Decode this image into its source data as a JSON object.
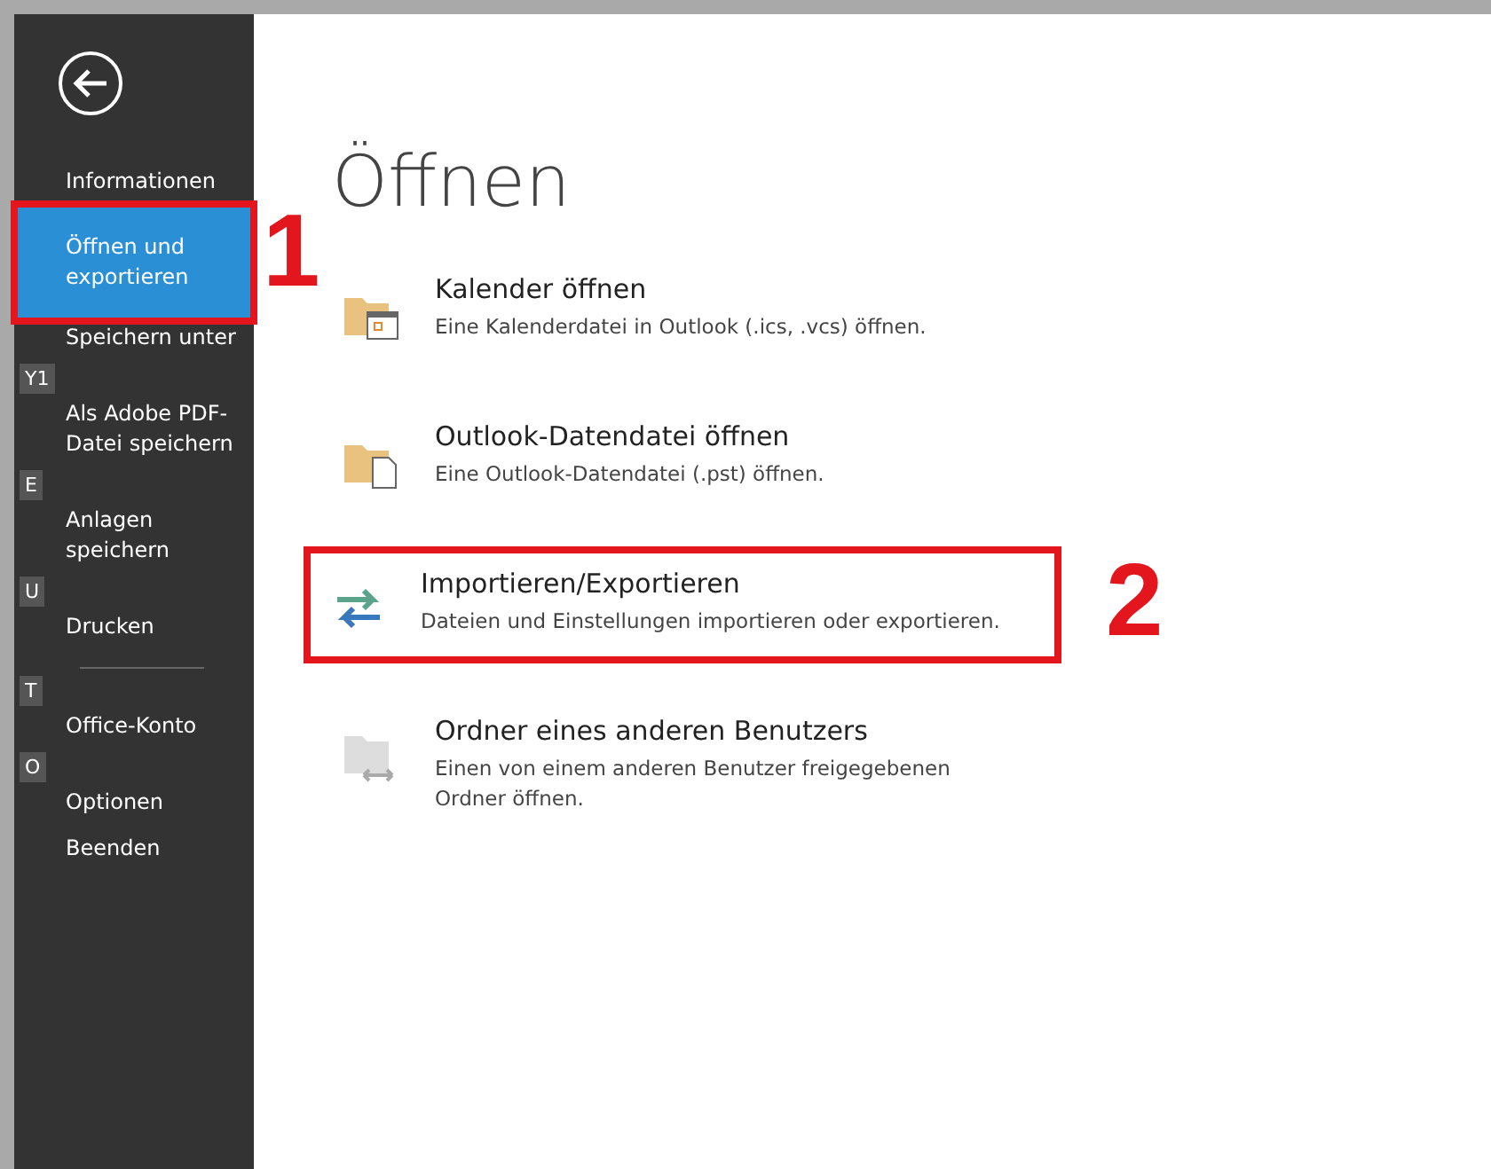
{
  "sidebar": {
    "items": [
      {
        "label": "Informationen",
        "selected": false,
        "highlighted": false
      },
      {
        "label": "Öffnen und exportieren",
        "selected": true,
        "highlighted": true,
        "callout": "1"
      },
      {
        "label": "Speichern unter",
        "selected": false,
        "highlighted": false
      },
      {
        "keytip": "Y1",
        "label": "Als Adobe PDF-Datei speichern",
        "selected": false,
        "highlighted": false
      },
      {
        "keytip": "E",
        "label": "Anlagen speichern",
        "selected": false,
        "highlighted": false
      },
      {
        "keytip": "U",
        "label": "Drucken",
        "selected": false,
        "highlighted": false,
        "divider_after": true
      },
      {
        "keytip": "T",
        "label": "Office-Konto",
        "selected": false,
        "highlighted": false
      },
      {
        "keytip": "O",
        "label": "Optionen",
        "selected": false,
        "highlighted": false
      },
      {
        "label": "Beenden",
        "selected": false,
        "highlighted": false
      }
    ]
  },
  "page": {
    "title": "Öffnen",
    "options": [
      {
        "kind": "calendar",
        "title": "Kalender öffnen",
        "description": "Eine Kalenderdatei in Outlook (.ics, .vcs) öffnen.",
        "highlighted": false
      },
      {
        "kind": "datafile",
        "title": "Outlook-Datendatei öffnen",
        "description": "Eine Outlook-Datendatei (.pst) öffnen.",
        "highlighted": false
      },
      {
        "kind": "import-export",
        "title": "Importieren/Exportieren",
        "description": "Dateien und Einstellungen importieren oder exportieren.",
        "highlighted": true,
        "callout": "2"
      },
      {
        "kind": "shared-folder",
        "title": "Ordner eines anderen Benutzers",
        "description": "Einen von einem anderen Benutzer freigegebenen Ordner öffnen.",
        "highlighted": false
      }
    ]
  }
}
